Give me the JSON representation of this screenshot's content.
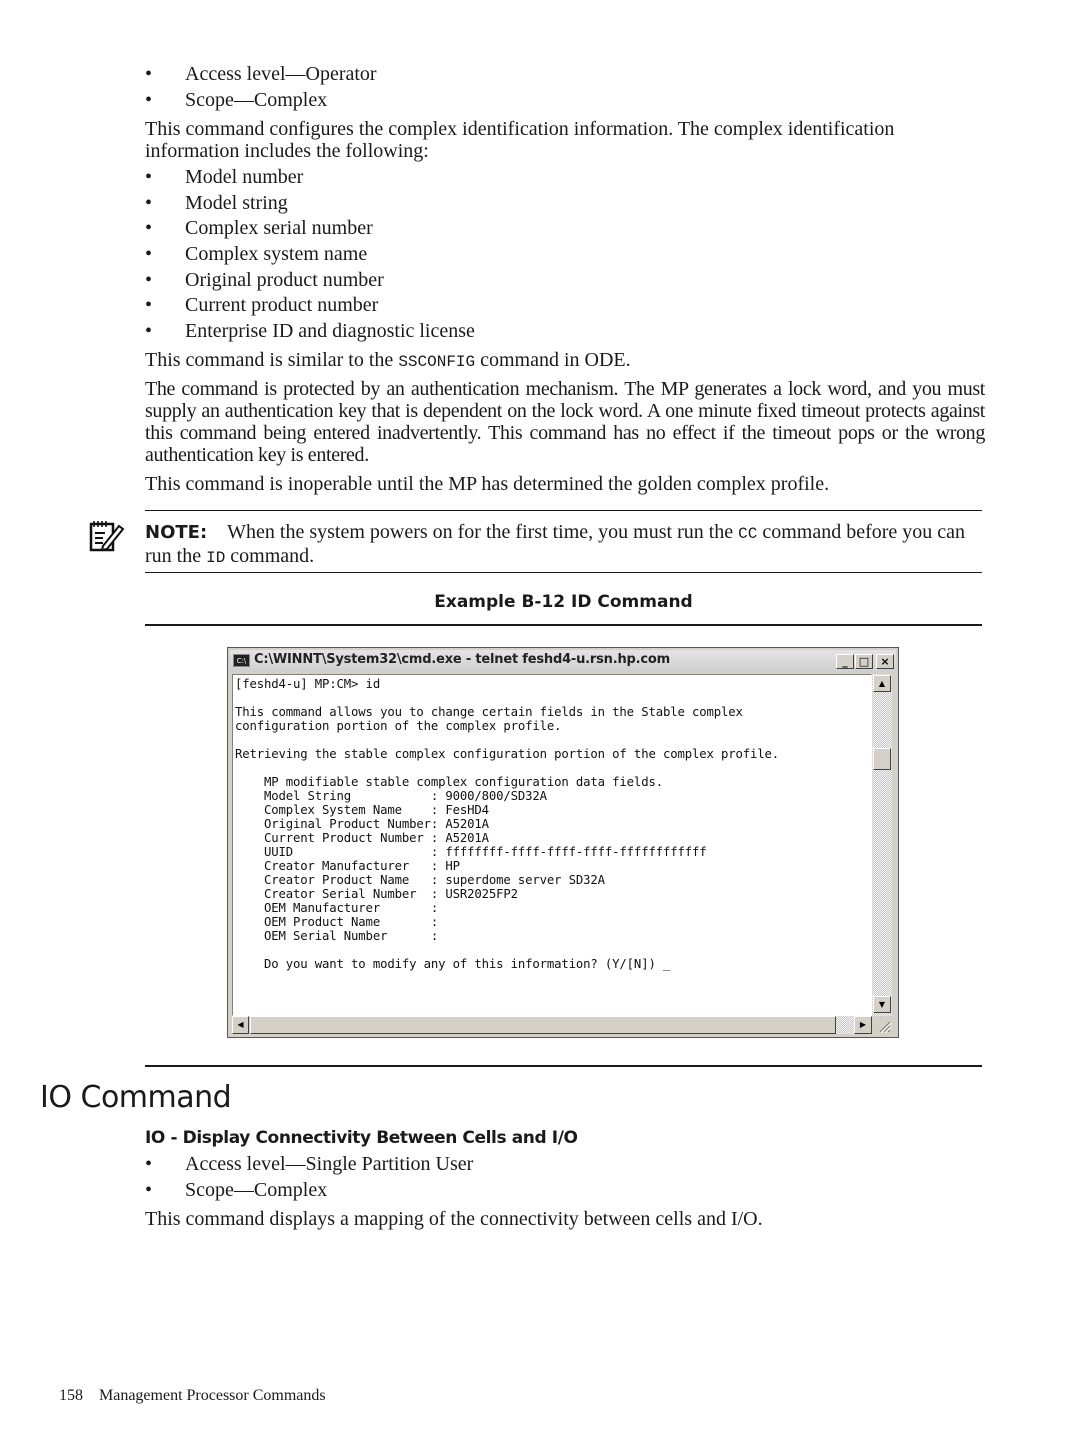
{
  "top_section": {
    "bullets": [
      "Access level—Operator",
      "Scope—Complex"
    ],
    "intro": "This command configures the complex identification information. The complex identification information includes the following:",
    "info_items": [
      "Model number",
      "Model string",
      "Complex serial number",
      "Complex system name",
      "Original product number",
      "Current product number",
      "Enterprise ID and diagnostic license"
    ],
    "similar_pre": "This command is similar to the ",
    "similar_code": "SSCONFIG",
    "similar_post": " command in ODE.",
    "auth_paragraph": "The command is protected by an authentication mechanism. The MP generates a lock word, and you must supply an authentication key that is dependent on the lock word. A one minute fixed timeout protects against this command being entered inadvertently. This command has no effect if the timeout pops or the wrong authentication key is entered.",
    "inoperable_paragraph": "This command is inoperable until the MP has determined the golden complex profile."
  },
  "note": {
    "icon": "note-pencil-icon",
    "label": "NOTE:",
    "text_pre": "When the system powers on for the first time, you must run the ",
    "code1": "CC",
    "text_mid": " command before you can run the ",
    "code2": "ID",
    "text_post": " command."
  },
  "example": {
    "caption": "Example B-12 ID Command",
    "window": {
      "title": "C:\\WINNT\\System32\\cmd.exe - telnet feshd4-u.rsn.hp.com",
      "app_icon_label": "C:\\",
      "buttons": {
        "minimize": "_",
        "maximize": "□",
        "close": "×"
      },
      "scroll": {
        "up": "▲",
        "down": "▼",
        "left": "◀",
        "right": "▶"
      },
      "console_lines": [
        "[feshd4-u] MP:CM> id",
        "",
        "This command allows you to change certain fields in the Stable complex",
        "configuration portion of the complex profile.",
        "",
        "Retrieving the stable complex configuration portion of the complex profile.",
        "",
        "    MP modifiable stable complex configuration data fields.",
        "    Model String           : 9000/800/SD32A",
        "    Complex System Name    : FesHD4",
        "    Original Product Number: A5201A",
        "    Current Product Number : A5201A",
        "    UUID                   : ffffffff-ffff-ffff-ffff-ffffffffffff",
        "    Creator Manufacturer   : HP",
        "    Creator Product Name   : superdome server SD32A",
        "    Creator Serial Number  : USR2025FP2",
        "    OEM Manufacturer       :",
        "    OEM Product Name       :",
        "    OEM Serial Number      :",
        "",
        "    Do you want to modify any of this information? (Y/[N]) _"
      ]
    }
  },
  "io_section": {
    "heading": "IO Command",
    "subheading": "IO - Display Connectivity Between Cells and I/O",
    "bullets": [
      "Access level—Single Partition User",
      "Scope—Complex"
    ],
    "description": "This command displays a mapping of the connectivity between cells and I/O."
  },
  "footer": {
    "page_number": "158",
    "section_title": "Management Processor Commands"
  },
  "bullet_glyph": "•"
}
